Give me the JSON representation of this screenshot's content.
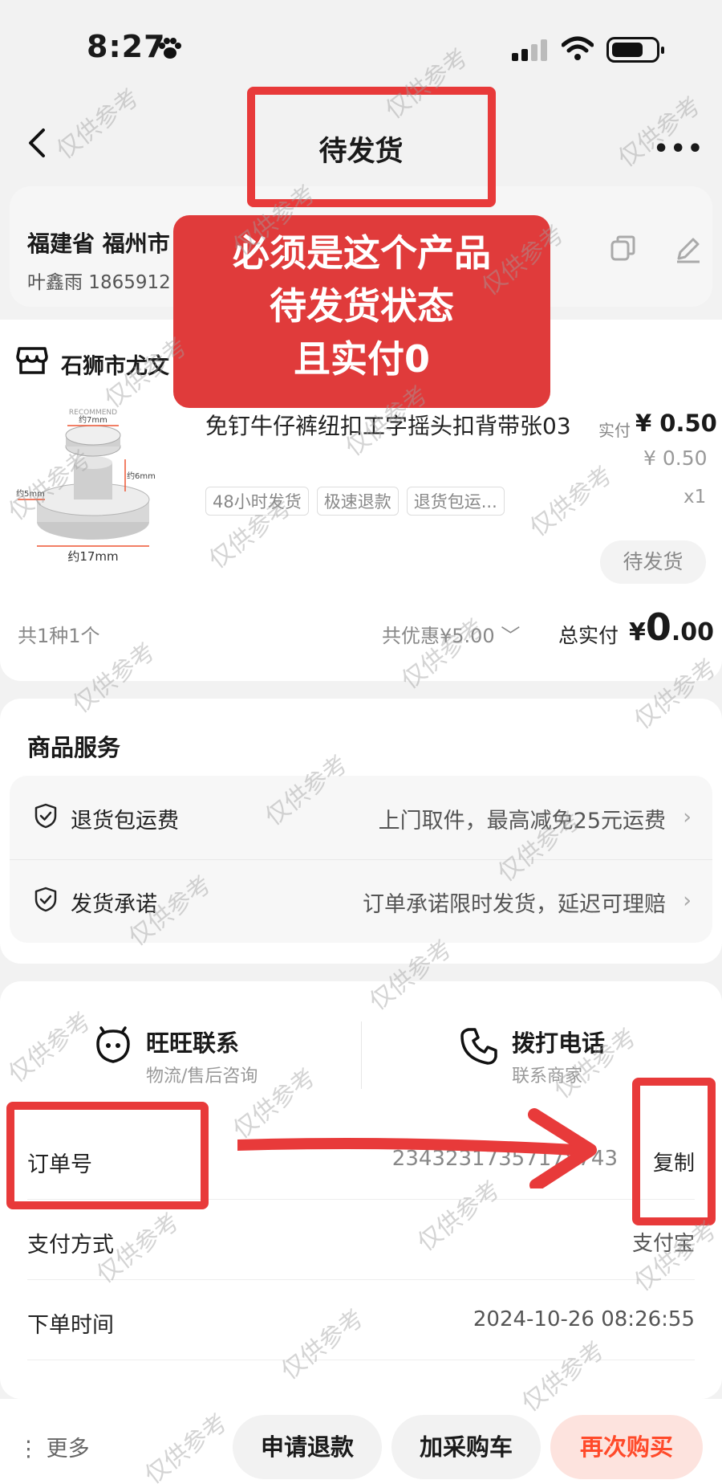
{
  "status_bar": {
    "time": "8:27"
  },
  "nav": {
    "title": "待发货"
  },
  "address": {
    "title": "福建省 福州市",
    "name_phone": "叶鑫雨 1865912"
  },
  "shop": {
    "name": "石狮市尤文"
  },
  "product": {
    "title": "免钉牛仔裤纽扣工字摇头扣背带张03",
    "price_label": "实付",
    "price": "¥ 0.50",
    "original_price": "¥ 0.50",
    "quantity": "x1",
    "tags": [
      "48小时发货",
      "极速退款",
      "退货包运..."
    ],
    "status": "待发货",
    "image_labels": [
      "约7mm",
      "约6mm",
      "约5mm",
      "约17mm",
      "RECOMMEND"
    ]
  },
  "summary": {
    "count": "共1种1个",
    "discount": "共优惠¥5.00",
    "total_label": "总实付",
    "total_currency": "¥",
    "total_int": "0",
    "total_dec": ".00"
  },
  "service": {
    "title": "商品服务",
    "rows": [
      {
        "label": "退货包运费",
        "value": "上门取件，最高减免25元运费"
      },
      {
        "label": "发货承诺",
        "value": "订单承诺限时发货，延迟可理赔"
      }
    ]
  },
  "contact": {
    "wangwang_label": "旺旺联系",
    "wangwang_sub": "物流/售后咨询",
    "phone_label": "拨打电话",
    "phone_sub": "联系商家"
  },
  "order_info": {
    "order_no_label": "订单号",
    "order_no_value": "23432317357178743",
    "copy_label": "复制",
    "pay_label": "支付方式",
    "pay_value": "支付宝",
    "time_label": "下单时间",
    "time_value": "2024-10-26 08:26:55"
  },
  "bottom_bar": {
    "more": "更多",
    "refund": "申请退款",
    "add_cart": "加采购车",
    "rebuy": "再次购买"
  },
  "annotation": {
    "line1": "必须是这个产品",
    "line2": "待发货状态",
    "line3": "且实付0"
  },
  "watermark": "仅供参考",
  "colors": {
    "accent": "#ff4a2a",
    "annotation": "#e03b3b"
  }
}
